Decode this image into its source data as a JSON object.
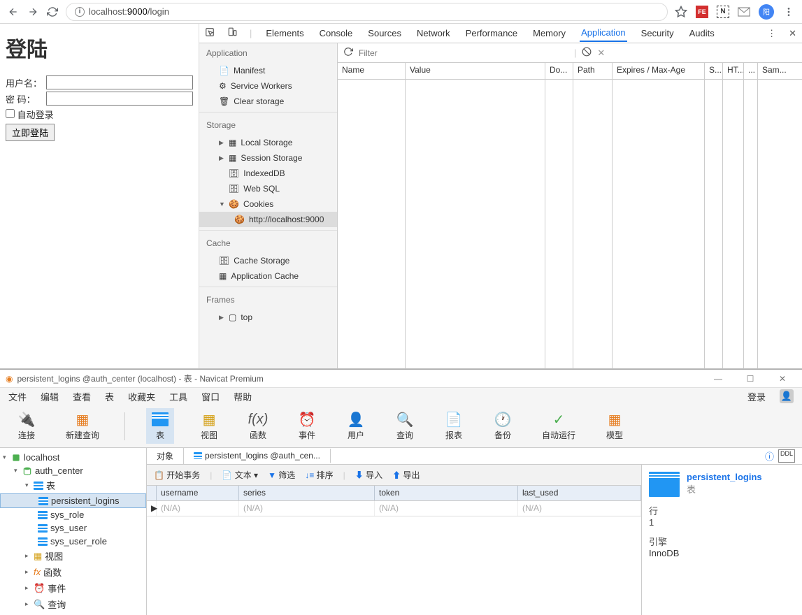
{
  "browser": {
    "url_host": "localhost:",
    "url_port": "9000",
    "url_path": "/login"
  },
  "page": {
    "heading": "登陆",
    "label_user": "用户名：",
    "label_pass": "密   码：",
    "checkbox": "自动登录",
    "submit": "立即登陆"
  },
  "devtools": {
    "tabs": [
      "Elements",
      "Console",
      "Sources",
      "Network",
      "Performance",
      "Memory",
      "Application",
      "Security",
      "Audits"
    ],
    "active_tab": "Application",
    "side": {
      "app_head": "Application",
      "manifest": "Manifest",
      "sw": "Service Workers",
      "clear": "Clear storage",
      "storage_head": "Storage",
      "local": "Local Storage",
      "session": "Session Storage",
      "idb": "IndexedDB",
      "websql": "Web SQL",
      "cookies": "Cookies",
      "cookie_origin": "http://localhost:9000",
      "cache_head": "Cache",
      "cache_storage": "Cache Storage",
      "app_cache": "Application Cache",
      "frames_head": "Frames",
      "top": "top"
    },
    "filter_placeholder": "Filter",
    "cols": {
      "name": "Name",
      "value": "Value",
      "do": "Do...",
      "path": "Path",
      "exp": "Expires / Max-Age",
      "s": "S...",
      "ht": "HT...",
      "dots": "...",
      "sam": "Sam..."
    }
  },
  "navicat": {
    "title": "persistent_logins @auth_center (localhost) - 表 - Navicat Premium",
    "menu": [
      "文件",
      "编辑",
      "查看",
      "表",
      "收藏夹",
      "工具",
      "窗口",
      "帮助"
    ],
    "login": "登录",
    "tools": {
      "conn": "连接",
      "newq": "新建查询",
      "table": "表",
      "view": "视图",
      "func": "函数",
      "event": "事件",
      "user": "用户",
      "query": "查询",
      "report": "报表",
      "backup": "备份",
      "auto": "自动运行",
      "model": "模型"
    },
    "tree": {
      "localhost": "localhost",
      "auth_center": "auth_center",
      "tables": "表",
      "persistent_logins": "persistent_logins",
      "sys_role": "sys_role",
      "sys_user": "sys_user",
      "sys_user_role": "sys_user_role",
      "views": "视图",
      "funcs": "函数",
      "events": "事件",
      "queries": "查询"
    },
    "tabs": {
      "obj": "对象",
      "pl": "persistent_logins @auth_cen..."
    },
    "toolbar": {
      "begin": "开始事务",
      "text": "文本",
      "filter": "筛选",
      "sort": "排序",
      "import": "导入",
      "export": "导出"
    },
    "grid": {
      "username": "username",
      "series": "series",
      "token": "token",
      "last_used": "last_used",
      "na": "(N/A)"
    },
    "info": {
      "title": "persistent_logins",
      "type": "表",
      "rows_label": "行",
      "rows": "1",
      "engine_label": "引擎",
      "engine": "InnoDB"
    }
  }
}
